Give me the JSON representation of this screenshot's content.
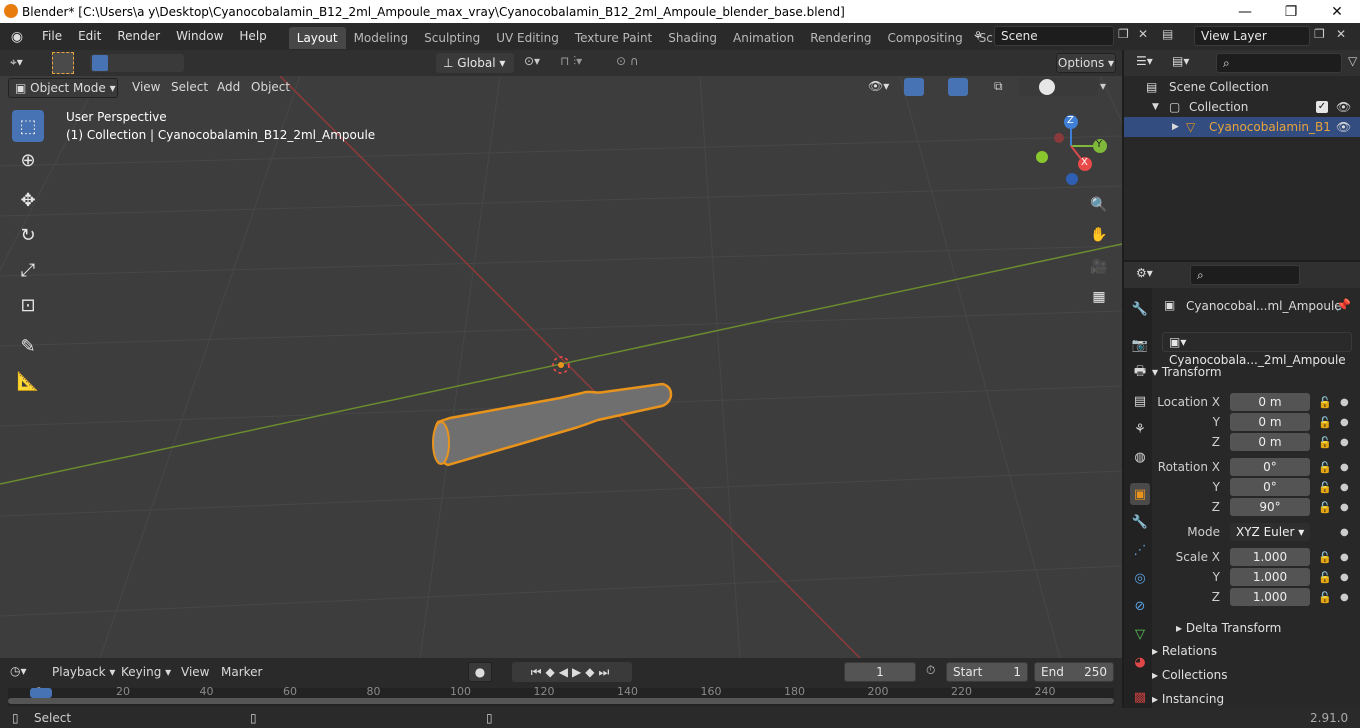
{
  "window": {
    "title": "Blender* [C:\\Users\\a y\\Desktop\\Cyanocobalamin_B12_2ml_Ampoule_max_vray\\Cyanocobalamin_B12_2ml_Ampoule_blender_base.blend]",
    "minimize": "—",
    "maximize": "❐",
    "close": "✕"
  },
  "menu": [
    "File",
    "Edit",
    "Render",
    "Window",
    "Help"
  ],
  "workspaces": [
    "Layout",
    "Modeling",
    "Sculpting",
    "UV Editing",
    "Texture Paint",
    "Shading",
    "Animation",
    "Rendering",
    "Compositing",
    "Scripting"
  ],
  "scene": {
    "name": "Scene",
    "view_layer": "View Layer"
  },
  "toolbar": {
    "orientation": "Global",
    "options": "Options"
  },
  "viewport_header": {
    "mode": "Object Mode",
    "view": "View",
    "select": "Select",
    "add": "Add",
    "object": "Object"
  },
  "viewport": {
    "perspective": "User Perspective",
    "collection_info": "(1) Collection | Cyanocobalamin_B12_2ml_Ampoule"
  },
  "gizmo": {
    "x": "X",
    "y": "Y",
    "z": "Z"
  },
  "outliner": {
    "scene_collection": "Scene Collection",
    "collection": "Collection",
    "object": "Cyanocobalamin_B1"
  },
  "properties": {
    "object_name": "Cyanocobal...ml_Ampoule",
    "data_name": "Cyanocobala..._2ml_Ampoule",
    "transform": "Transform",
    "location": {
      "label": "Location X",
      "x": "0 m",
      "y": "0 m",
      "z": "0 m"
    },
    "rotation": {
      "label": "Rotation X",
      "x": "0°",
      "y": "0°",
      "z": "90°"
    },
    "mode_label": "Mode",
    "mode": "XYZ Euler",
    "scale": {
      "label": "Scale X",
      "x": "1.000",
      "y": "1.000",
      "z": "1.000"
    },
    "y_label": "Y",
    "z_label": "Z",
    "delta": "Delta Transform",
    "relations": "Relations",
    "collections": "Collections",
    "instancing": "Instancing"
  },
  "timeline": {
    "playback": "Playback",
    "keying": "Keying",
    "view": "View",
    "marker": "Marker",
    "frame": "1",
    "start_label": "Start",
    "start": "1",
    "end_label": "End",
    "end": "250",
    "ticks": [
      "1",
      "20",
      "40",
      "60",
      "80",
      "100",
      "120",
      "140",
      "160",
      "180",
      "200",
      "220",
      "240"
    ]
  },
  "status": {
    "select": "Select",
    "version": "2.91.0"
  }
}
